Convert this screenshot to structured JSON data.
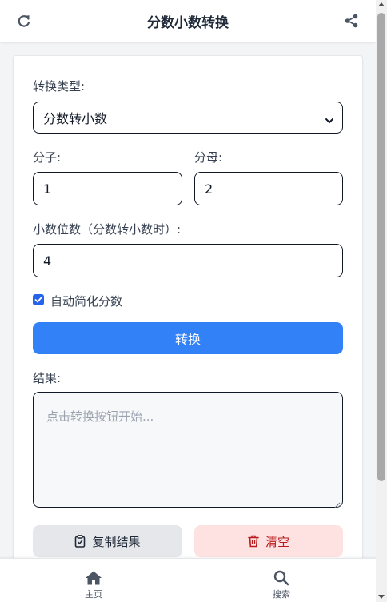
{
  "header": {
    "title": "分数小数转换",
    "refresh_icon": "refresh-icon",
    "share_icon": "share-icon"
  },
  "form": {
    "conversion_type_label": "转换类型:",
    "conversion_type_value": "分数转小数",
    "numerator_label": "分子:",
    "numerator_value": "1",
    "denominator_label": "分母:",
    "denominator_value": "2",
    "decimal_places_label": "小数位数（分数转小数时）:",
    "decimal_places_value": "4",
    "auto_simplify_label": "自动简化分数",
    "auto_simplify_checked": true,
    "convert_button": "转换",
    "result_label": "结果:",
    "result_placeholder": "点击转换按钮开始..."
  },
  "actions": {
    "copy_button": "复制结果",
    "clear_button": "清空"
  },
  "bottom_nav": [
    {
      "label": "主页",
      "icon": "home-icon"
    },
    {
      "label": "搜索",
      "icon": "search-icon"
    }
  ],
  "colors": {
    "primary": "#3381f6",
    "danger_text": "#b91c1c",
    "danger_bg": "#fee2e2"
  }
}
